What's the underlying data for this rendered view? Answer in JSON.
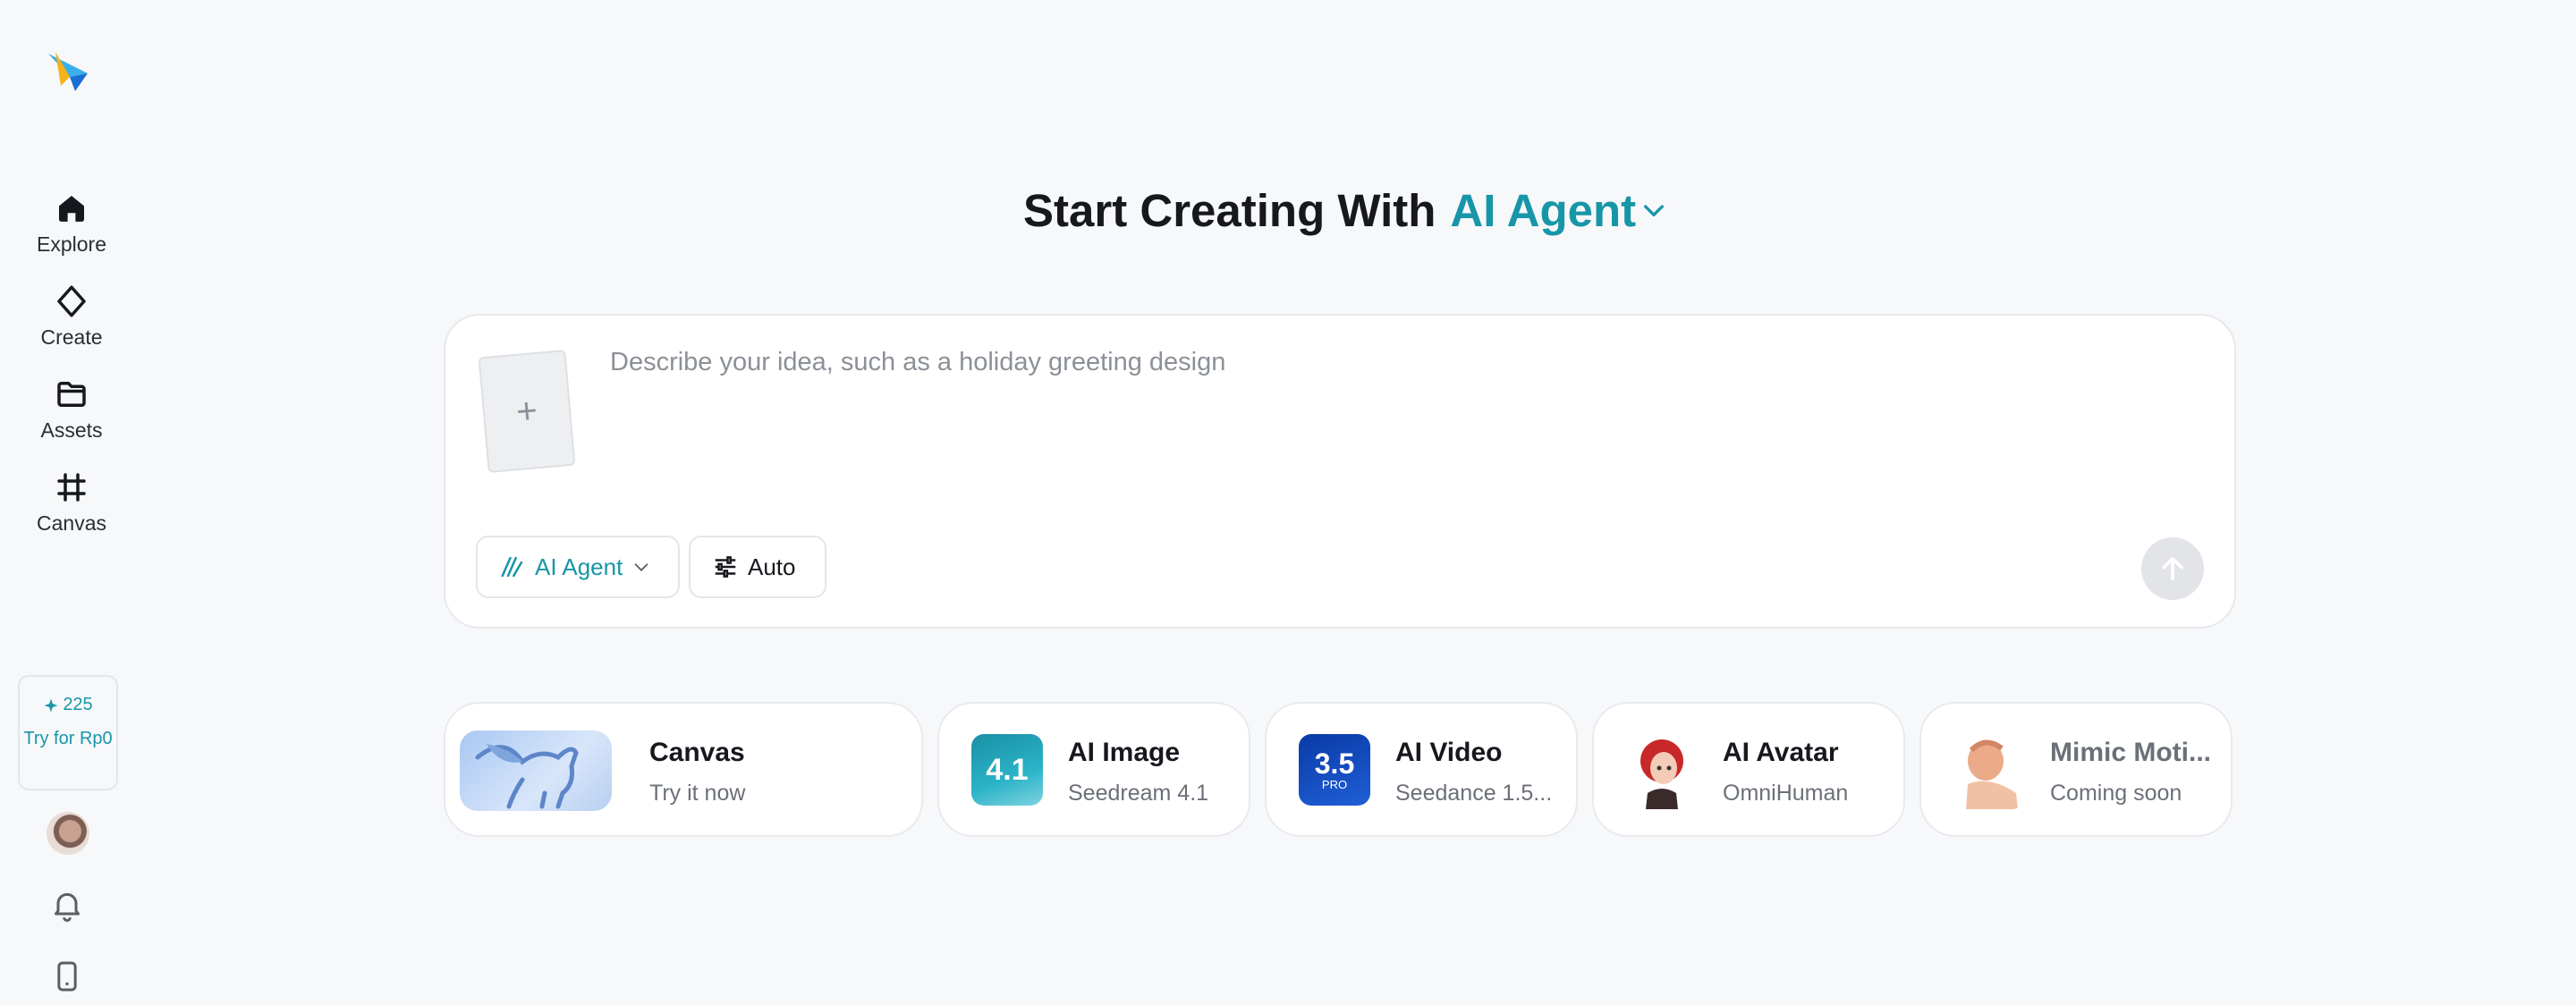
{
  "sidebar": {
    "items": [
      {
        "label": "Explore",
        "icon": "home-icon"
      },
      {
        "label": "Create",
        "icon": "sparkle-icon"
      },
      {
        "label": "Assets",
        "icon": "folder-icon"
      },
      {
        "label": "Canvas",
        "icon": "frame-icon"
      }
    ],
    "credits": {
      "count": "225",
      "cta": "Try for Rp0"
    }
  },
  "header": {
    "title": "Start Creating With",
    "mode": "AI Agent"
  },
  "composer": {
    "placeholder": "Describe your idea, such as a holiday greeting design",
    "mode_label": "AI Agent",
    "settings_label": "Auto"
  },
  "cards": [
    {
      "title": "Canvas",
      "subtitle": "Try it now"
    },
    {
      "title": "AI Image",
      "subtitle": "Seedream 4.1",
      "badge": "4.1"
    },
    {
      "title": "AI Video",
      "subtitle": "Seedance 1.5...",
      "badge": "3.5",
      "badge_sub": "PRO"
    },
    {
      "title": "AI Avatar",
      "subtitle": "OmniHuman"
    },
    {
      "title": "Mimic Moti...",
      "subtitle": "Coming soon"
    }
  ],
  "colors": {
    "accent": "#1796a8",
    "background": "#f7f8fa"
  }
}
